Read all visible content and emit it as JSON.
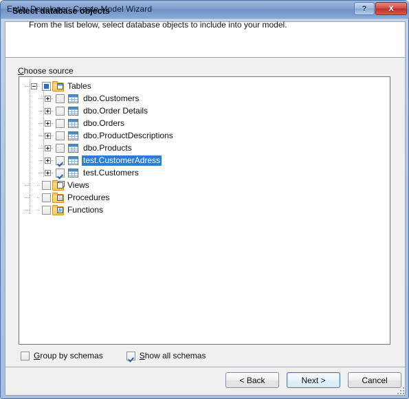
{
  "window": {
    "title": "Entity Developer: Create Model Wizard",
    "caption_buttons": [
      {
        "name": "help-button",
        "label": "?"
      },
      {
        "name": "close-button",
        "label": "X"
      }
    ]
  },
  "header": {
    "title": "Select database objects",
    "subtitle": "From the list below, select database objects to include into your model."
  },
  "group": {
    "label_mnemonic": "C",
    "label_rest": "hoose source"
  },
  "tree": {
    "nodes": [
      {
        "label": "Tables",
        "level": 0,
        "expander": "minus",
        "check": "partial",
        "icon": "folder-tables-icon",
        "selected": false
      },
      {
        "label": "dbo.Customers",
        "level": 1,
        "expander": "plus",
        "check": "unchecked",
        "icon": "table-icon",
        "selected": false
      },
      {
        "label": "dbo.Order Details",
        "level": 1,
        "expander": "plus",
        "check": "unchecked",
        "icon": "table-icon",
        "selected": false
      },
      {
        "label": "dbo.Orders",
        "level": 1,
        "expander": "plus",
        "check": "unchecked",
        "icon": "table-icon",
        "selected": false
      },
      {
        "label": "dbo.ProductDescriptions",
        "level": 1,
        "expander": "plus",
        "check": "unchecked",
        "icon": "table-icon",
        "selected": false
      },
      {
        "label": "dbo.Products",
        "level": 1,
        "expander": "plus",
        "check": "unchecked",
        "icon": "table-icon",
        "selected": false
      },
      {
        "label": "test.CustomerAdress",
        "level": 1,
        "expander": "plus",
        "check": "checked",
        "icon": "table-icon",
        "selected": true
      },
      {
        "label": "test.Customers",
        "level": 1,
        "expander": "plus",
        "check": "checked",
        "icon": "table-icon",
        "selected": false
      },
      {
        "label": "Views",
        "level": 0,
        "expander": "none",
        "check": "unchecked",
        "icon": "folder-views-icon",
        "selected": false
      },
      {
        "label": "Procedures",
        "level": 0,
        "expander": "none",
        "check": "unchecked",
        "icon": "folder-procedures-icon",
        "selected": false
      },
      {
        "label": "Functions",
        "level": 0,
        "expander": "none",
        "check": "unchecked",
        "icon": "folder-functions-icon",
        "selected": false
      }
    ]
  },
  "options": [
    {
      "name": "group-by-schemas-checkbox",
      "mnemonic": "G",
      "rest": "roup by schemas",
      "checked": false
    },
    {
      "name": "show-all-schemas-checkbox",
      "mnemonic": "S",
      "rest": "how all schemas",
      "checked": true
    }
  ],
  "buttons": [
    {
      "name": "back-button",
      "label": "< Back",
      "default": false
    },
    {
      "name": "next-button",
      "label": "Next >",
      "default": true
    },
    {
      "name": "cancel-button",
      "label": "Cancel",
      "default": false
    }
  ],
  "colors": {
    "titlebar_accent": "#7fa0ce",
    "selection": "#2a7fd4",
    "close_button": "#bc3228",
    "default_button_border": "#3c7fb1"
  }
}
